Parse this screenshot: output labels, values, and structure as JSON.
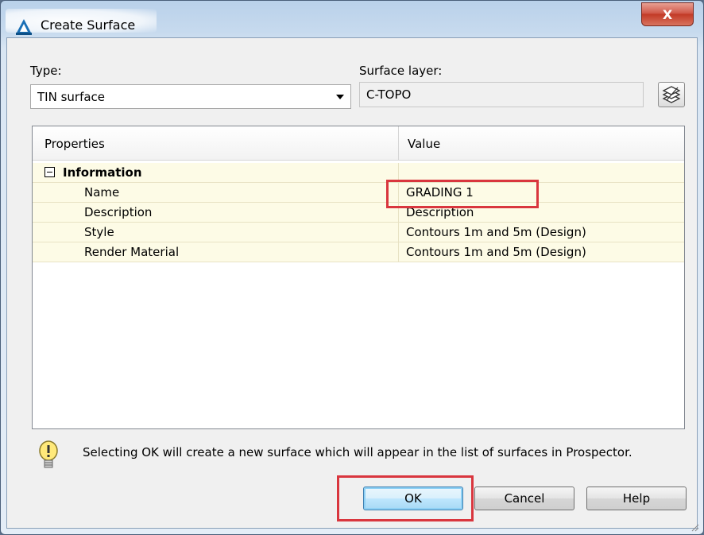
{
  "window": {
    "title": "Create Surface",
    "close_label": "X"
  },
  "type_field": {
    "label": "Type:",
    "value": "TIN surface"
  },
  "surface_layer": {
    "label": "Surface layer:",
    "value": "C-TOPO"
  },
  "grid": {
    "headers": [
      "Properties",
      "Value"
    ],
    "category": "Information",
    "rows": [
      {
        "property": "Name",
        "value": "GRADING 1"
      },
      {
        "property": "Description",
        "value": "Description"
      },
      {
        "property": "Style",
        "value": "Contours 1m and 5m (Design)"
      },
      {
        "property": "Render Material",
        "value": "Contours 1m and 5m (Design)"
      }
    ]
  },
  "info_message": "Selecting OK will create a new surface which will appear in the list of surfaces in Prospector.",
  "buttons": {
    "ok": "OK",
    "cancel": "Cancel",
    "help": "Help"
  },
  "colors": {
    "highlight": "#d9363e",
    "row_background": "#fdfbe6",
    "title_gradient": "#b9d1ea"
  },
  "icons": {
    "app": "autocad-civil-icon",
    "layer": "layer-icon",
    "info": "lightbulb-icon"
  }
}
